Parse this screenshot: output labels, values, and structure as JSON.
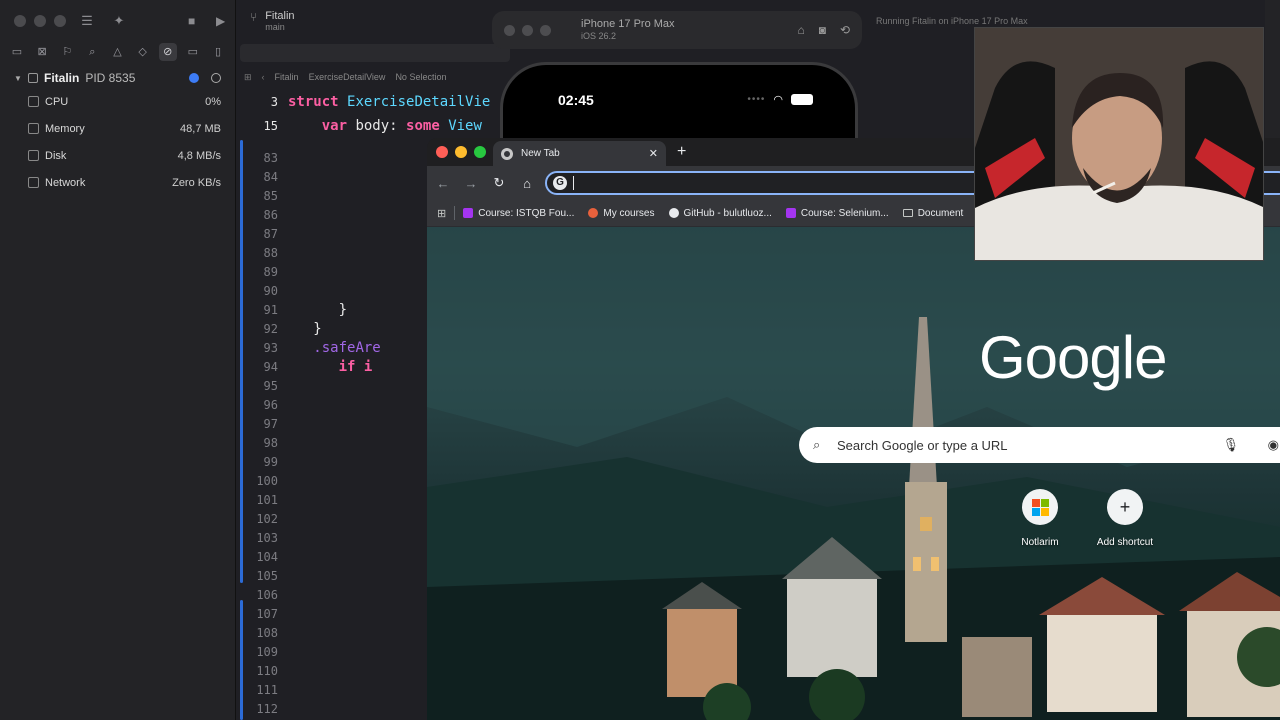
{
  "sidebar": {
    "process": {
      "name": "Fitalin",
      "pid": "PID 8535"
    },
    "gauges": [
      {
        "label": "CPU",
        "value": "0%",
        "icon": "cpu-icon"
      },
      {
        "label": "Memory",
        "value": "48,7 MB",
        "icon": "memory-icon"
      },
      {
        "label": "Disk",
        "value": "4,8 MB/s",
        "icon": "disk-icon"
      },
      {
        "label": "Network",
        "value": "Zero KB/s",
        "icon": "network-icon"
      }
    ]
  },
  "editor": {
    "project": "Fitalin",
    "branch": "main",
    "run_status": "Running Fitalin on iPhone 17 Pro Max",
    "jumpbar": {
      "project": "Fitalin",
      "file": "ExerciseDetailView",
      "selection": "No Selection"
    },
    "line3": {
      "num": "3",
      "kw": "struct",
      "name": "ExerciseDetailVie"
    },
    "line15": {
      "num": "15",
      "kw1": "var",
      "name": "body:",
      "kw2": "some",
      "type": "View"
    },
    "line_numbers": [
      "83",
      "84",
      "85",
      "86",
      "87",
      "88",
      "89",
      "90",
      "91",
      "92",
      "93",
      "94",
      "95",
      "96",
      "97",
      "98",
      "99",
      "100",
      "101",
      "102",
      "103",
      "104",
      "105",
      "106",
      "107",
      "108",
      "109",
      "110",
      "111",
      "112"
    ],
    "line91": "}",
    "line92": "}",
    "line93": ".safeAre",
    "line94": "if i"
  },
  "simulator": {
    "device": "iPhone 17 Pro Max",
    "os": "iOS 26.2",
    "time": "02:45"
  },
  "chrome": {
    "tab_title": "New Tab",
    "omnibox_value": "",
    "bookmarks": [
      {
        "label": "Course: ISTQB Fou...",
        "icon": "udemy-icon"
      },
      {
        "label": "My courses",
        "icon": "courses-icon"
      },
      {
        "label": "GitHub - bulutluoz...",
        "icon": "github-icon"
      },
      {
        "label": "Course: Selenium...",
        "icon": "udemy-icon"
      },
      {
        "label": "Document",
        "icon": "folder-icon"
      }
    ],
    "ntp": {
      "logo": "Google",
      "search_placeholder": "Search Google or type a URL",
      "shortcuts": [
        {
          "label": "Notlarim",
          "icon": "microsoft-icon"
        },
        {
          "label": "Add shortcut",
          "icon": "plus-icon"
        }
      ]
    }
  },
  "colors": {
    "accent": "#8ab4f8",
    "keyword": "#fc5fa3",
    "type": "#5dd8ff",
    "function": "#a167e6",
    "traffic_red": "#ff5f57",
    "traffic_yellow": "#febc2e",
    "traffic_green": "#28c840"
  }
}
